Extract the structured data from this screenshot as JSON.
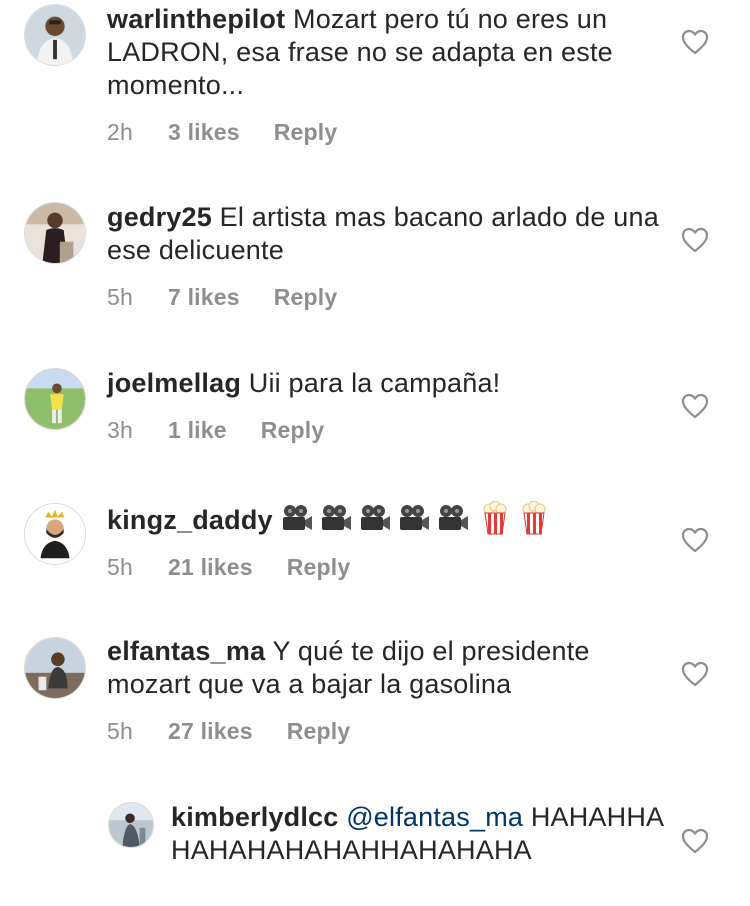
{
  "comments": [
    {
      "username": "warlinthepilot",
      "text": "Mozart pero tú no eres un LADRON, esa frase no se adapta en este momento...",
      "time": "2h",
      "likes": "3 likes",
      "reply": "Reply"
    },
    {
      "username": "gedry25",
      "text": "El artista mas bacano arlado de una ese delicuente",
      "time": "5h",
      "likes": "7 likes",
      "reply": "Reply"
    },
    {
      "username": "joelmellag",
      "text": "Uii para la campaña!",
      "time": "3h",
      "likes": "1 like",
      "reply": "Reply"
    },
    {
      "username": "kingz_daddy",
      "text": "",
      "emojis": [
        "movie-camera",
        "movie-camera",
        "movie-camera",
        "movie-camera",
        "movie-camera",
        "popcorn",
        "popcorn"
      ],
      "time": "5h",
      "likes": "21 likes",
      "reply": "Reply"
    },
    {
      "username": "elfantas_ma",
      "text": "Y qué te dijo el presidente mozart que va a bajar la gasolina",
      "time": "5h",
      "likes": "27 likes",
      "reply": "Reply"
    }
  ],
  "reply_comment": {
    "username": "kimberlydlcc",
    "mention": "@elfantas_ma",
    "text": "HAHAHHAHAHAHAHAHAHHAHAHAHA"
  },
  "colors": {
    "text": "#262626",
    "meta": "#8e8e8e",
    "mention": "#003569",
    "heart": "#8e8e8e"
  }
}
